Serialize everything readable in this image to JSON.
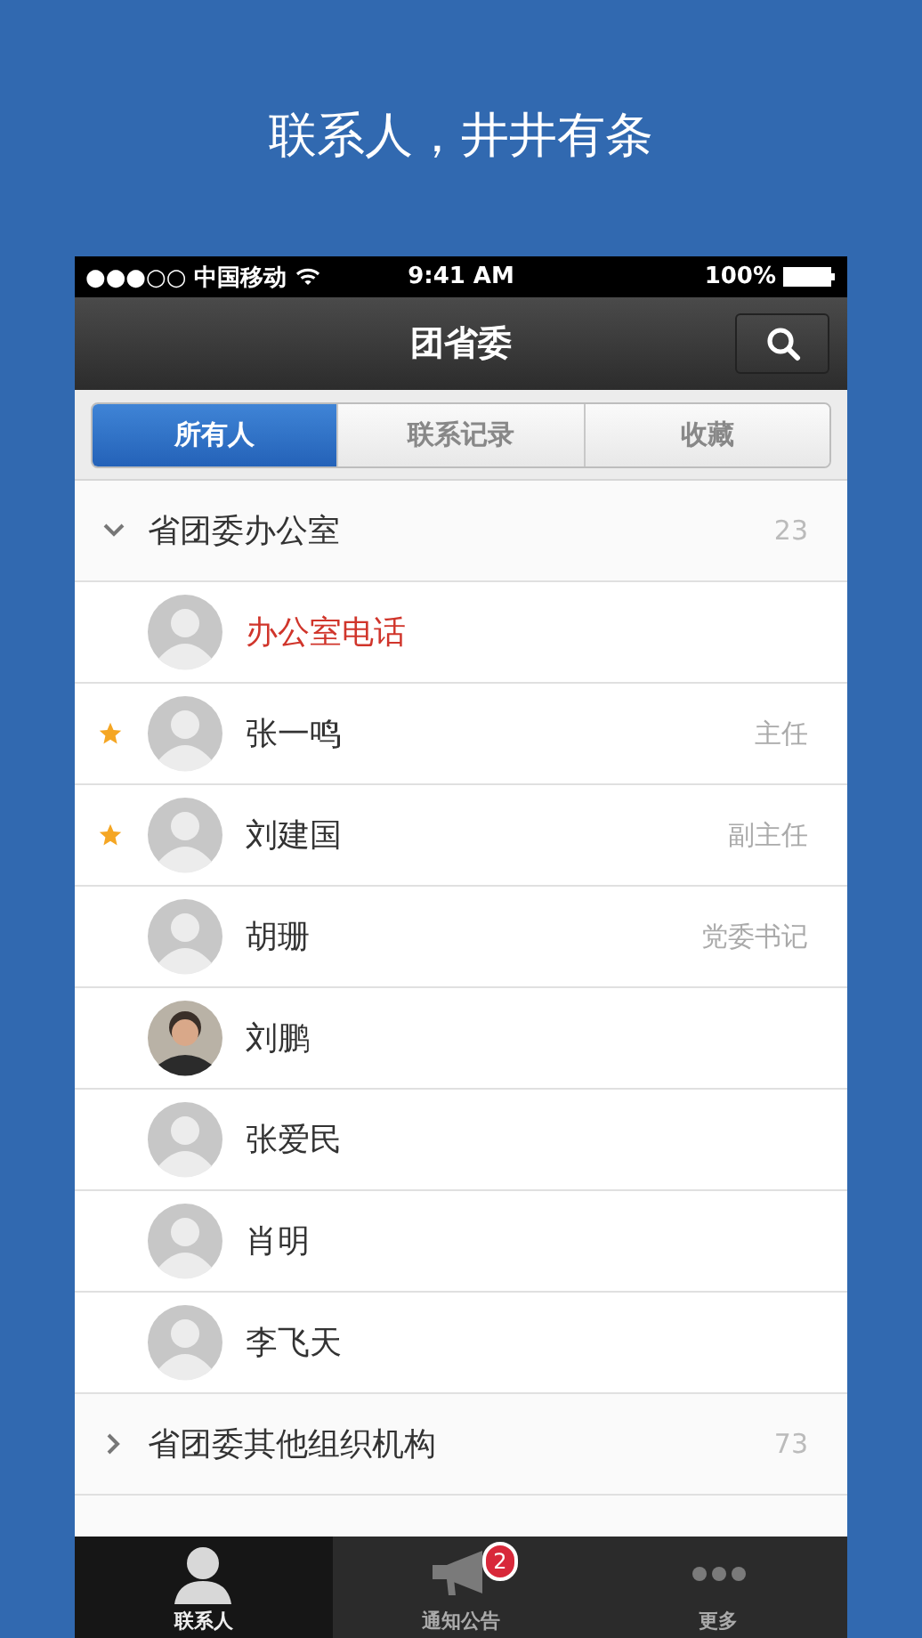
{
  "headline": "联系人，井井有条",
  "status_bar": {
    "carrier": "●●●○○ 中国移动",
    "time": "9:41 AM",
    "battery": "100%"
  },
  "nav_bar": {
    "title": "团省委"
  },
  "segments": [
    {
      "label": "所有人",
      "selected": true
    },
    {
      "label": "联系记录",
      "selected": false
    },
    {
      "label": "收藏",
      "selected": false
    }
  ],
  "groups": [
    {
      "name": "省团委办公室",
      "count": "23",
      "expanded": true,
      "members": [
        {
          "name": "办公室电话",
          "highlighted": true,
          "starred": false,
          "kind": "default"
        },
        {
          "name": "张一鸣",
          "role": "主任",
          "highlighted": false,
          "starred": true,
          "kind": "default"
        },
        {
          "name": "刘建国",
          "role": "副主任",
          "highlighted": false,
          "starred": true,
          "kind": "default"
        },
        {
          "name": "胡珊",
          "role": "党委书记",
          "highlighted": false,
          "starred": false,
          "kind": "default"
        },
        {
          "name": "刘鹏",
          "highlighted": false,
          "starred": false,
          "kind": "photo"
        },
        {
          "name": "张爱民",
          "highlighted": false,
          "starred": false,
          "kind": "default"
        },
        {
          "name": "肖明",
          "highlighted": false,
          "starred": false,
          "kind": "default"
        },
        {
          "name": "李飞天",
          "highlighted": false,
          "starred": false,
          "kind": "default"
        }
      ]
    },
    {
      "name": "省团委其他组织机构",
      "count": "73",
      "expanded": false
    }
  ],
  "tab_bar": [
    {
      "label": "联系人",
      "kind": "person",
      "selected": true
    },
    {
      "label": "通知公告",
      "kind": "megaphone",
      "selected": false,
      "badge": "2"
    },
    {
      "label": "更多",
      "kind": "more",
      "selected": false
    }
  ]
}
